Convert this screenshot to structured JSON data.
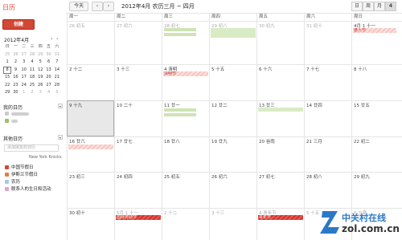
{
  "app": {
    "title": "日历",
    "create_label": "创建"
  },
  "toolbar": {
    "today": "今天",
    "prev": "‹",
    "next": "›",
    "date_range": "2012年4月 农历三月 ~ 四月",
    "views": [
      "日",
      "周",
      "月",
      "4"
    ]
  },
  "mini": {
    "title": "2012年4月",
    "nav": [
      "‹",
      "›"
    ],
    "weekdays": [
      "日",
      "一",
      "二",
      "三",
      "四",
      "五",
      "六"
    ],
    "weeks": [
      [
        "25",
        "26",
        "27",
        "28",
        "29",
        "30",
        "31"
      ],
      [
        "1",
        "2",
        "3",
        "4",
        "5",
        "6",
        "7"
      ],
      [
        "8",
        "9",
        "10",
        "11",
        "12",
        "13",
        "14"
      ],
      [
        "15",
        "16",
        "17",
        "18",
        "19",
        "20",
        "21"
      ],
      [
        "22",
        "23",
        "24",
        "25",
        "26",
        "27",
        "28"
      ],
      [
        "29",
        "30",
        "1",
        "2",
        "3",
        "4",
        "5"
      ]
    ]
  },
  "my_calendars": {
    "title": "我的日历"
  },
  "other_calendars": {
    "title": "其他日历",
    "add_placeholder": "添加朋友的日历",
    "nyk": "New York Knicks",
    "items": [
      {
        "label": "中国节假日",
        "color": "#d14836"
      },
      {
        "label": "伊斯兰节假日",
        "color": "#e67c44"
      },
      {
        "label": "农历",
        "color": "#a4c8e8"
      },
      {
        "label": "联系人的生日和活动",
        "color": "#e3a1d5"
      }
    ]
  },
  "grid": {
    "day_headers": [
      "周一",
      "周二",
      "周三",
      "周四",
      "周五",
      "周六",
      "周日"
    ],
    "weeks": [
      [
        "26 初五",
        "27 初六",
        "28 初七",
        "29 初八",
        "30 初九",
        "31 初十",
        "4月 1 十一"
      ],
      [
        "2 十二",
        "3 十三",
        "4 清明",
        "5 十五",
        "6 十六",
        "7 十七",
        "8 十八"
      ],
      [
        "9 十九",
        "10 二十",
        "11 廿一",
        "12 廿二",
        "13 廿三",
        "14 廿四",
        "15 廿五"
      ],
      [
        "16 廿六",
        "17 廿七",
        "18 廿八",
        "19 廿九",
        "20 谷雨",
        "21 三月",
        "22 初二"
      ],
      [
        "23 初三",
        "24 初四",
        "25 初五",
        "26 初六",
        "27 初七",
        "28 初八",
        "29 初九"
      ],
      [
        "30 初十",
        "5月 1 十一",
        "2 十二",
        "3 十三",
        "4 青年节",
        "5 十五",
        "6 立夏"
      ]
    ],
    "events": {
      "fools": "愚人节",
      "qingming": "清明节",
      "labor": "国际劳动节",
      "youth": "青年节"
    }
  },
  "watermark": {
    "brand": "中关村在线",
    "url": "zol.com.cn"
  },
  "colors": {
    "accent": "#d14836",
    "event_red": "#d53030"
  }
}
